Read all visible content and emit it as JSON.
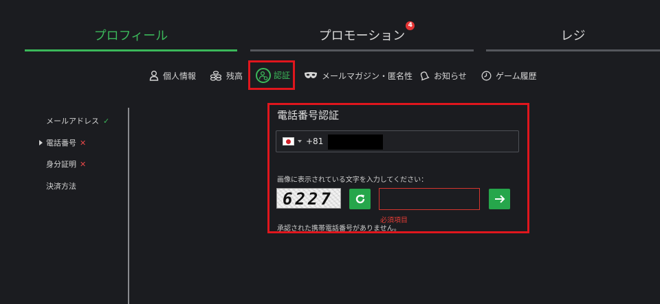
{
  "tabs": [
    {
      "label": "プロフィール",
      "active": true
    },
    {
      "label": "プロモーション",
      "badge": "4"
    },
    {
      "label": "レジ"
    }
  ],
  "subnav": {
    "personal": "個人情報",
    "balance": "残高",
    "verify": "認証",
    "newsletter": "メールマガジン・匿名性",
    "notices": "お知らせ",
    "history": "ゲーム履歴"
  },
  "menu": {
    "email": "メールアドレス",
    "phone": "電話番号",
    "identity": "身分証明",
    "payment": "決済方法"
  },
  "phone_verify": {
    "title": "電話番号認証",
    "dial_code": "+81",
    "captcha_label": "画像に表示されている文字を入力してください：",
    "captcha_code": "6227",
    "input_value": "",
    "required": "必須項目",
    "note": "承認された携帯電話番号がありません。"
  },
  "colors": {
    "accent": "#3bb85a",
    "error": "#e84848",
    "highlight_box": "#e0161d"
  }
}
